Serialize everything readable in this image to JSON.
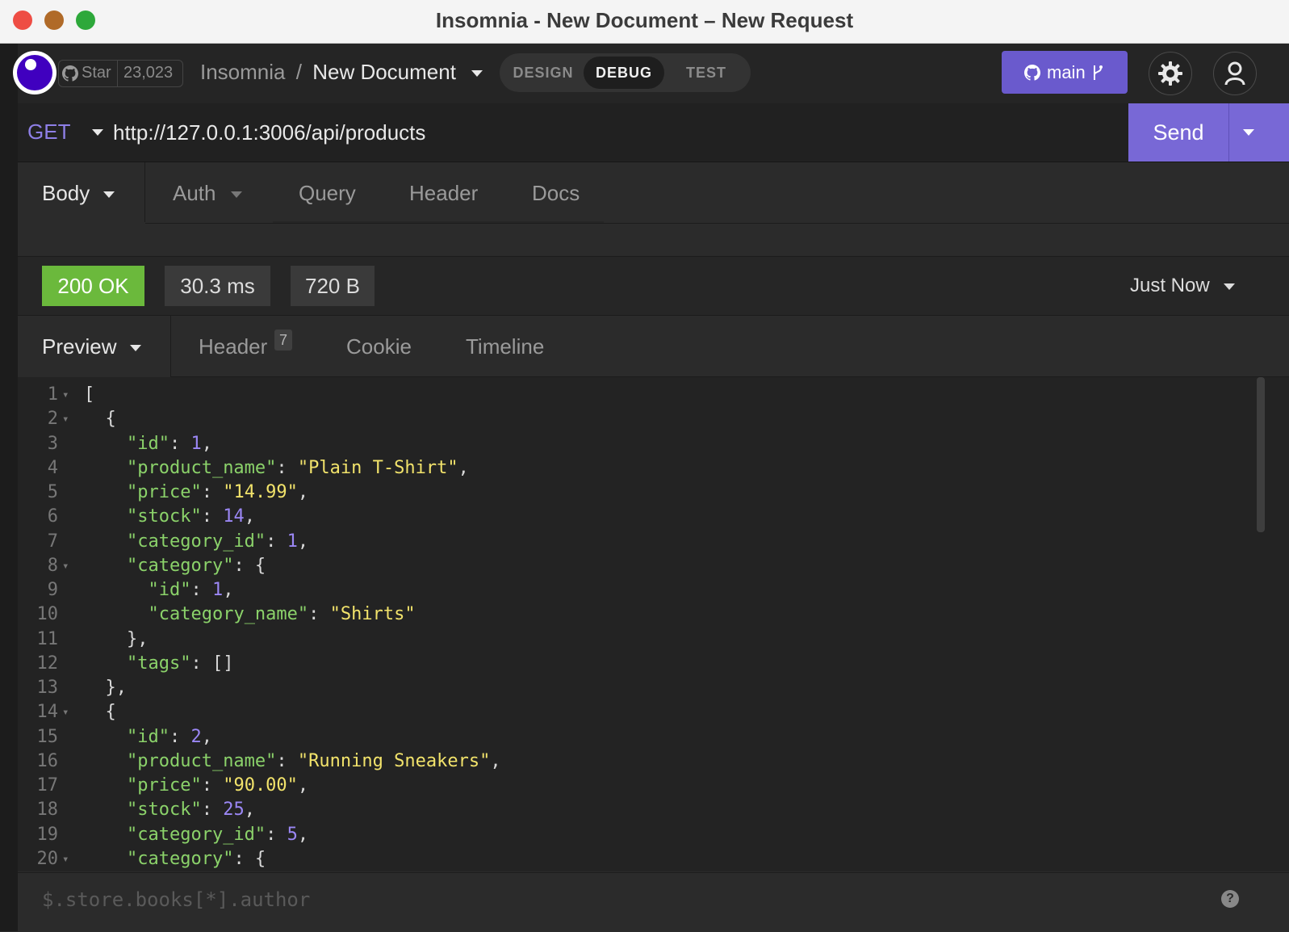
{
  "window": {
    "title": "Insomnia - New Document – New Request",
    "traffic_light_colors": [
      "#ee4d44",
      "#b06a28",
      "#2da83a"
    ]
  },
  "header": {
    "star_label": "Star",
    "star_count": "23,023",
    "breadcrumb_app": "Insomnia",
    "breadcrumb_separator": "/",
    "breadcrumb_document": "New Document",
    "mode_tabs": [
      "DESIGN",
      "DEBUG",
      "TEST"
    ],
    "active_mode": "DEBUG",
    "branch_label": "main"
  },
  "request": {
    "method": "GET",
    "url": "http://127.0.0.1:3006/api/products",
    "send_label": "Send",
    "tabs": [
      "Body",
      "Auth",
      "Query",
      "Header",
      "Docs"
    ],
    "active_tab": "Body"
  },
  "response": {
    "status": "200 OK",
    "time": "30.3 ms",
    "size": "720 B",
    "history_label": "Just Now",
    "tabs": [
      "Preview",
      "Header",
      "Cookie",
      "Timeline"
    ],
    "header_count": "7",
    "active_tab": "Preview"
  },
  "editor": {
    "lines": [
      {
        "n": "1",
        "fold": true,
        "tokens": [
          [
            "p",
            "["
          ]
        ]
      },
      {
        "n": "2",
        "fold": true,
        "tokens": [
          [
            "p",
            "  {"
          ]
        ]
      },
      {
        "n": "3",
        "fold": false,
        "tokens": [
          [
            "p",
            "    "
          ],
          [
            "k",
            "\"id\""
          ],
          [
            "p",
            ": "
          ],
          [
            "n",
            "1"
          ],
          [
            "p",
            ","
          ]
        ]
      },
      {
        "n": "4",
        "fold": false,
        "tokens": [
          [
            "p",
            "    "
          ],
          [
            "k",
            "\"product_name\""
          ],
          [
            "p",
            ": "
          ],
          [
            "s",
            "\"Plain T-Shirt\""
          ],
          [
            "p",
            ","
          ]
        ]
      },
      {
        "n": "5",
        "fold": false,
        "tokens": [
          [
            "p",
            "    "
          ],
          [
            "k",
            "\"price\""
          ],
          [
            "p",
            ": "
          ],
          [
            "s",
            "\"14.99\""
          ],
          [
            "p",
            ","
          ]
        ]
      },
      {
        "n": "6",
        "fold": false,
        "tokens": [
          [
            "p",
            "    "
          ],
          [
            "k",
            "\"stock\""
          ],
          [
            "p",
            ": "
          ],
          [
            "n",
            "14"
          ],
          [
            "p",
            ","
          ]
        ]
      },
      {
        "n": "7",
        "fold": false,
        "tokens": [
          [
            "p",
            "    "
          ],
          [
            "k",
            "\"category_id\""
          ],
          [
            "p",
            ": "
          ],
          [
            "n",
            "1"
          ],
          [
            "p",
            ","
          ]
        ]
      },
      {
        "n": "8",
        "fold": true,
        "tokens": [
          [
            "p",
            "    "
          ],
          [
            "k",
            "\"category\""
          ],
          [
            "p",
            ": {"
          ]
        ]
      },
      {
        "n": "9",
        "fold": false,
        "tokens": [
          [
            "p",
            "      "
          ],
          [
            "k",
            "\"id\""
          ],
          [
            "p",
            ": "
          ],
          [
            "n",
            "1"
          ],
          [
            "p",
            ","
          ]
        ]
      },
      {
        "n": "10",
        "fold": false,
        "tokens": [
          [
            "p",
            "      "
          ],
          [
            "k",
            "\"category_name\""
          ],
          [
            "p",
            ": "
          ],
          [
            "s",
            "\"Shirts\""
          ]
        ]
      },
      {
        "n": "11",
        "fold": false,
        "tokens": [
          [
            "p",
            "    },"
          ]
        ]
      },
      {
        "n": "12",
        "fold": false,
        "tokens": [
          [
            "p",
            "    "
          ],
          [
            "k",
            "\"tags\""
          ],
          [
            "p",
            ": []"
          ]
        ]
      },
      {
        "n": "13",
        "fold": false,
        "tokens": [
          [
            "p",
            "  },"
          ]
        ]
      },
      {
        "n": "14",
        "fold": true,
        "tokens": [
          [
            "p",
            "  {"
          ]
        ]
      },
      {
        "n": "15",
        "fold": false,
        "tokens": [
          [
            "p",
            "    "
          ],
          [
            "k",
            "\"id\""
          ],
          [
            "p",
            ": "
          ],
          [
            "n",
            "2"
          ],
          [
            "p",
            ","
          ]
        ]
      },
      {
        "n": "16",
        "fold": false,
        "tokens": [
          [
            "p",
            "    "
          ],
          [
            "k",
            "\"product_name\""
          ],
          [
            "p",
            ": "
          ],
          [
            "s",
            "\"Running Sneakers\""
          ],
          [
            "p",
            ","
          ]
        ]
      },
      {
        "n": "17",
        "fold": false,
        "tokens": [
          [
            "p",
            "    "
          ],
          [
            "k",
            "\"price\""
          ],
          [
            "p",
            ": "
          ],
          [
            "s",
            "\"90.00\""
          ],
          [
            "p",
            ","
          ]
        ]
      },
      {
        "n": "18",
        "fold": false,
        "tokens": [
          [
            "p",
            "    "
          ],
          [
            "k",
            "\"stock\""
          ],
          [
            "p",
            ": "
          ],
          [
            "n",
            "25"
          ],
          [
            "p",
            ","
          ]
        ]
      },
      {
        "n": "19",
        "fold": false,
        "tokens": [
          [
            "p",
            "    "
          ],
          [
            "k",
            "\"category_id\""
          ],
          [
            "p",
            ": "
          ],
          [
            "n",
            "5"
          ],
          [
            "p",
            ","
          ]
        ]
      },
      {
        "n": "20",
        "fold": true,
        "tokens": [
          [
            "p",
            "    "
          ],
          [
            "k",
            "\"category\""
          ],
          [
            "p",
            ": {"
          ]
        ]
      }
    ]
  },
  "filter": {
    "placeholder": "$.store.books[*].author"
  },
  "colors": {
    "accent": "#6a5acd",
    "status_ok": "#6bb93c"
  }
}
